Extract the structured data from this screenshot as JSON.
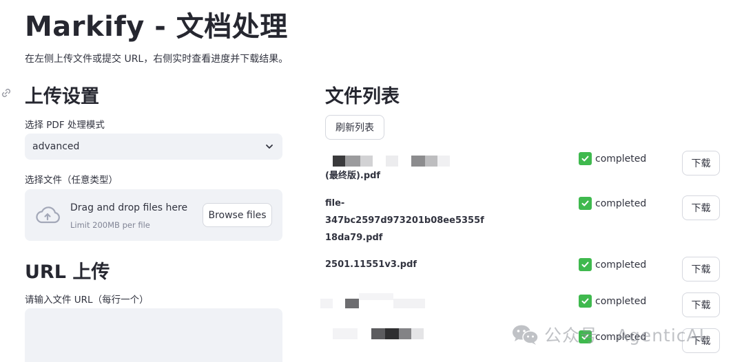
{
  "page": {
    "title": "Markify - 文档处理",
    "subtitle": "在左侧上传文件或提交 URL，右侧实时查看进度并下载结果。"
  },
  "upload": {
    "heading": "上传设置",
    "mode_label": "选择 PDF 处理模式",
    "mode_value": "advanced",
    "file_label": "选择文件（任意类型）",
    "drop_text": "Drag and drop files here",
    "drop_limit": "Limit 200MB per file",
    "browse_label": "Browse files"
  },
  "url_upload": {
    "heading": "URL 上传",
    "input_label": "请输入文件 URL（每行一个）",
    "input_value": ""
  },
  "file_list": {
    "heading": "文件列表",
    "refresh_label": "刷新列表",
    "download_label": "下载",
    "items": [
      {
        "name_lines": [
          "",
          "(最终版).pdf"
        ],
        "status": "completed"
      },
      {
        "name_lines": [
          "file-",
          "347bc2597d973201b08ee5355f",
          "18da79.pdf"
        ],
        "status": "completed"
      },
      {
        "name_lines": [
          "2501.11551v3.pdf"
        ],
        "status": "completed"
      },
      {
        "name_lines": [
          ""
        ],
        "status": "completed"
      },
      {
        "name_lines": [
          ""
        ],
        "status": "completed"
      }
    ]
  },
  "watermark": {
    "text": "公众号 · AgenticAI",
    "icon": "wechat-icon"
  },
  "colors": {
    "check_green": "#3fb94e",
    "input_bg": "#f0f2f6",
    "border": "#d5d7de"
  }
}
